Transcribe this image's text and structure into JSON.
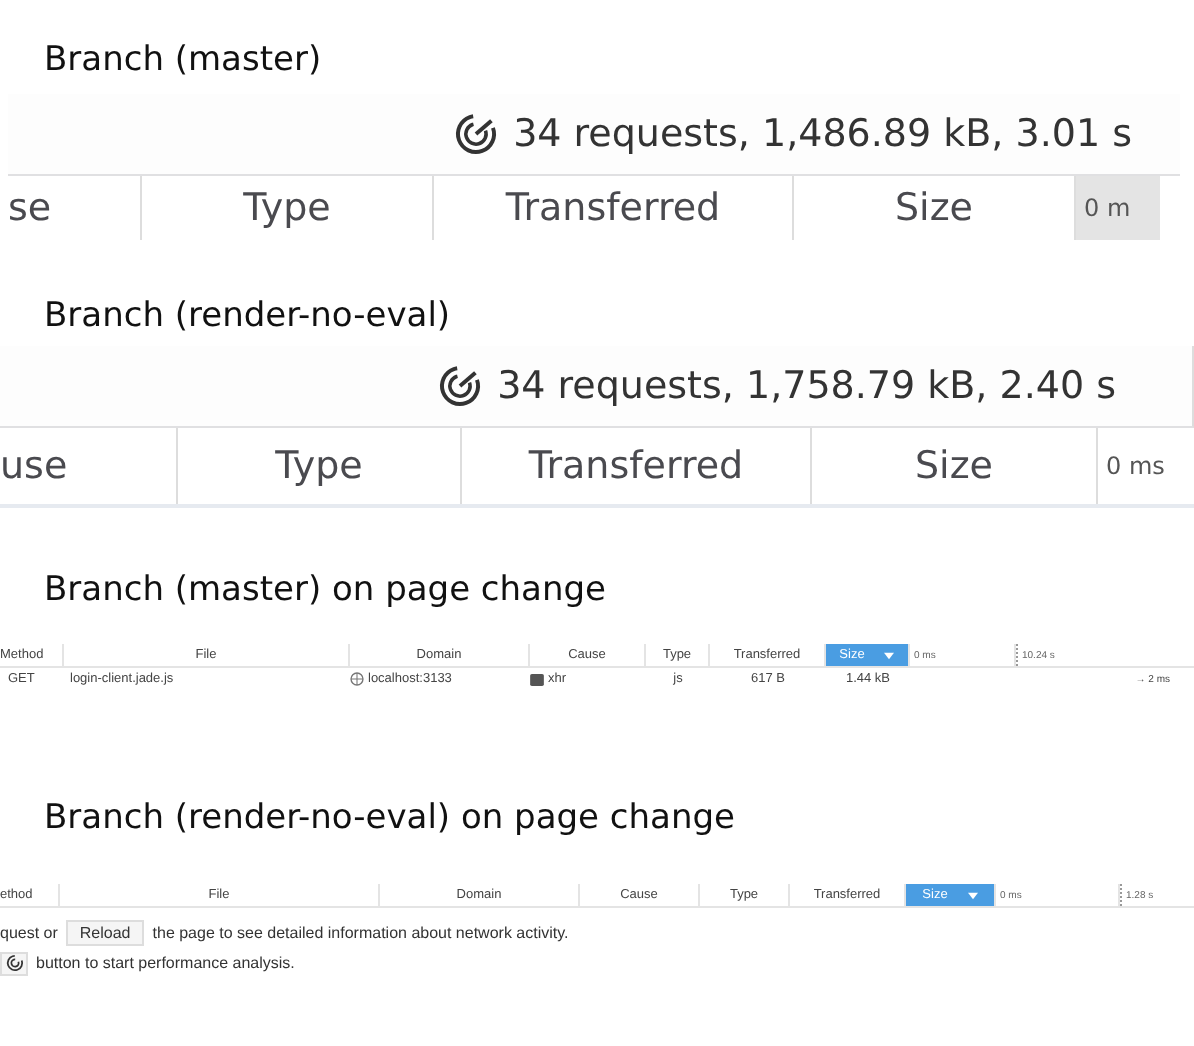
{
  "sections": [
    {
      "kind": "summary",
      "heading": "Branch (master)",
      "summary": "34 requests, 1,486.89 kB, 3.01 s",
      "columns": [
        "se",
        "Type",
        "Transferred",
        "Size"
      ],
      "timeline_label": "0 m"
    },
    {
      "kind": "summary",
      "heading": "Branch (render-no-eval)",
      "summary": "34 requests, 1,758.79 kB, 2.40 s",
      "columns": [
        "use",
        "Type",
        "Transferred",
        "Size"
      ],
      "timeline_label": "0 ms"
    },
    {
      "kind": "table",
      "heading": "Branch (master) on page change",
      "columns": [
        {
          "label": "Method",
          "selected": false
        },
        {
          "label": "File",
          "selected": false
        },
        {
          "label": "Domain",
          "selected": false
        },
        {
          "label": "Cause",
          "selected": false
        },
        {
          "label": "Type",
          "selected": false
        },
        {
          "label": "Transferred",
          "selected": false
        },
        {
          "label": "Size",
          "selected": true
        }
      ],
      "timeline": [
        "0 ms",
        "10.24 s"
      ],
      "rows": [
        {
          "cells": [
            "GET",
            "login-client.jade.js",
            "localhost:3133",
            "xhr",
            "js",
            "617 B",
            "1.44 kB"
          ],
          "timing": "→ 2 ms"
        }
      ]
    },
    {
      "kind": "table",
      "heading": "Branch (render-no-eval) on page change",
      "columns": [
        {
          "label": "ethod",
          "selected": false
        },
        {
          "label": "File",
          "selected": false
        },
        {
          "label": "Domain",
          "selected": false
        },
        {
          "label": "Cause",
          "selected": false
        },
        {
          "label": "Type",
          "selected": false
        },
        {
          "label": "Transferred",
          "selected": false
        },
        {
          "label": "Size",
          "selected": true
        }
      ],
      "timeline": [
        "0 ms",
        "1.28 s"
      ],
      "notice": {
        "before": "quest or",
        "button": "Reload",
        "after": "the page to see detailed information about network activity.",
        "hint": "button to start performance analysis."
      }
    }
  ]
}
